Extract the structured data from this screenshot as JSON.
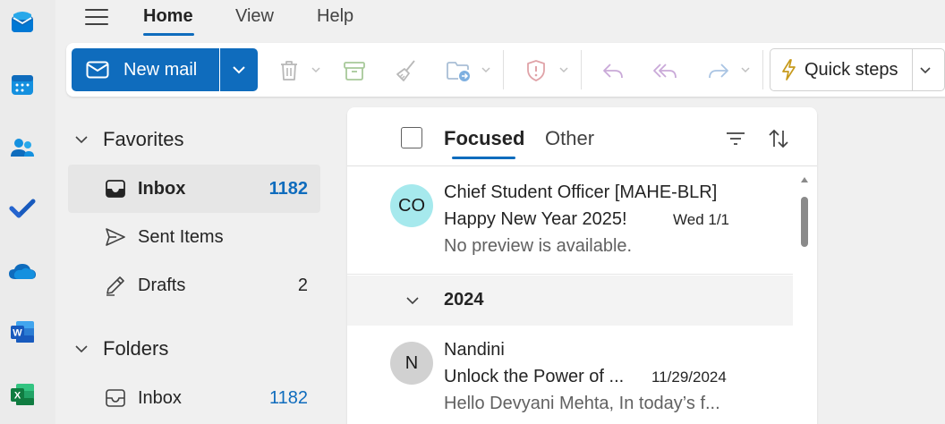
{
  "rail": {
    "apps": [
      "mail-icon",
      "calendar-icon",
      "people-icon",
      "todo-icon",
      "onedrive-icon",
      "word-icon",
      "excel-icon"
    ]
  },
  "nav": {
    "tabs": [
      {
        "label": "Home",
        "active": true
      },
      {
        "label": "View",
        "active": false
      },
      {
        "label": "Help",
        "active": false
      }
    ]
  },
  "ribbon": {
    "new_mail_label": "New mail",
    "quick_steps_label": "Quick steps"
  },
  "folders": {
    "favorites_label": "Favorites",
    "favorites": [
      {
        "label": "Inbox",
        "count": "1182"
      },
      {
        "label": "Sent Items",
        "count": ""
      },
      {
        "label": "Drafts",
        "count": "2"
      }
    ],
    "folders_label": "Folders",
    "folders": [
      {
        "label": "Inbox",
        "count": "1182"
      }
    ]
  },
  "message_list": {
    "tabs": [
      {
        "label": "Focused",
        "active": true
      },
      {
        "label": "Other",
        "active": false
      }
    ],
    "messages": [
      {
        "initials": "CO",
        "avatar_color": "#a6e9ed",
        "sender": "Chief Student Officer [MAHE-BLR]",
        "subject": "Happy New Year 2025!",
        "date": "Wed 1/1",
        "preview": "No preview is available."
      },
      {
        "initials": "N",
        "avatar_color": "#d1d1d1",
        "sender": "Nandini",
        "subject": "Unlock the Power of ...",
        "date": "11/29/2024",
        "preview": "Hello Devyani Mehta, In today’s f..."
      }
    ],
    "group_label": "2024"
  },
  "colors": {
    "accent": "#0f6cbd"
  }
}
